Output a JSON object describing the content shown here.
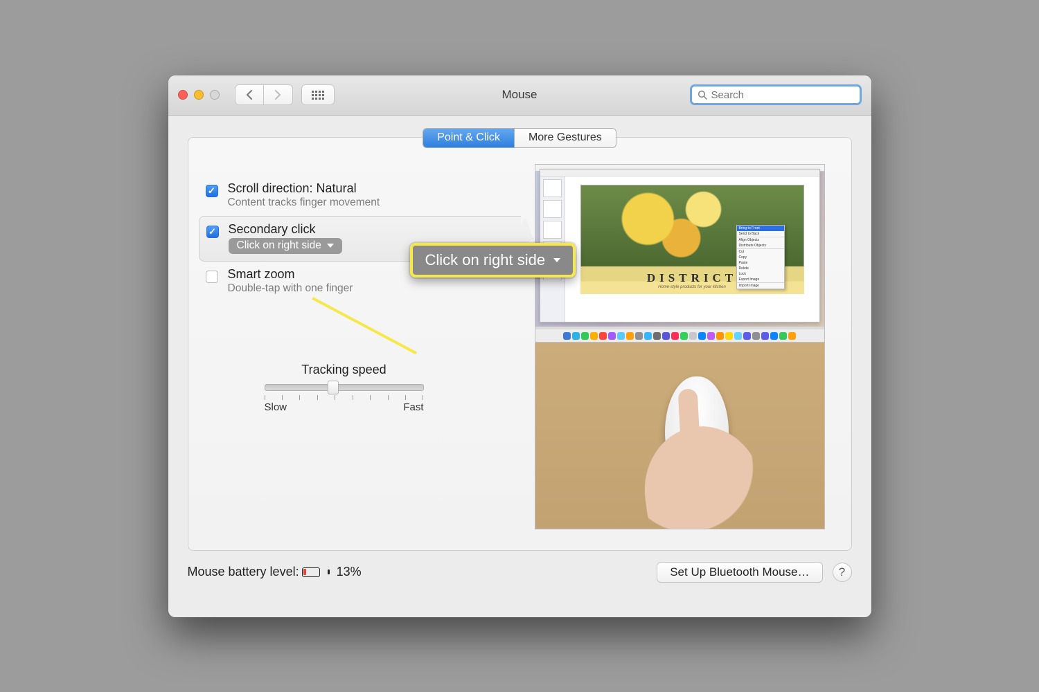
{
  "window": {
    "title": "Mouse"
  },
  "search": {
    "placeholder": "Search"
  },
  "tabs": {
    "point_click": "Point & Click",
    "more_gestures": "More Gestures"
  },
  "options": {
    "scroll": {
      "title": "Scroll direction: Natural",
      "sub": "Content tracks finger movement",
      "checked": true
    },
    "secondary": {
      "title": "Secondary click",
      "dropdown_value": "Click on right side",
      "checked": true
    },
    "smartzoom": {
      "title": "Smart zoom",
      "sub": "Double-tap with one finger",
      "checked": false
    }
  },
  "tracking": {
    "title": "Tracking speed",
    "slow": "Slow",
    "fast": "Fast",
    "ticks": 10,
    "position_pct": 43
  },
  "preview": {
    "banner_text": "DISTRICT",
    "banner_sub": "Home-style products for your kitchen",
    "context_menu": [
      "Bring to Front",
      "Send to Back",
      "—",
      "Align Objects",
      "Distribute Objects",
      "—",
      "Cut",
      "Copy",
      "Paste",
      "Delete",
      "Lock",
      "Export Image",
      "—",
      "Import Image"
    ],
    "dock_colors": [
      "#3b79d4",
      "#2bb1e6",
      "#34c759",
      "#ffae00",
      "#ff453a",
      "#a259ff",
      "#5ac8fa",
      "#ff9f0a",
      "#8e8e93",
      "#38b5ff",
      "#6d6d6d",
      "#5856d6",
      "#ff2d55",
      "#30d158",
      "#c7c7cc",
      "#0a84ff",
      "#bf5af2",
      "#ff9500",
      "#ffd60a",
      "#64d2ff",
      "#5e5ce6",
      "#8e8e93",
      "#5e5ce6",
      "#0a84ff",
      "#34c759",
      "#ff9f0a"
    ]
  },
  "callout": {
    "text": "Click on right side"
  },
  "footer": {
    "battery_label": "Mouse battery level:",
    "battery_pct": "13%",
    "bluetooth_button": "Set Up Bluetooth Mouse…"
  }
}
